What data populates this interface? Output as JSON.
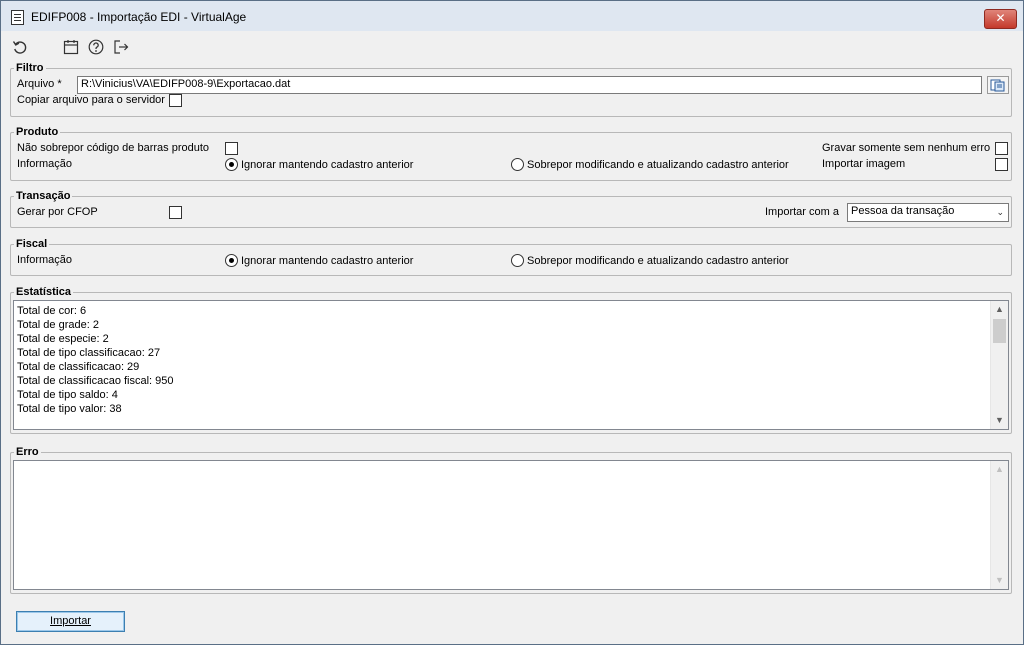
{
  "window": {
    "title": "EDIFP008 - Importação EDI - VirtualAge",
    "close_glyph": "✕"
  },
  "toolbar": {
    "icons": [
      "refresh-icon",
      "calendar-icon",
      "help-icon",
      "exit-icon"
    ]
  },
  "filtro": {
    "legend": "Filtro",
    "arquivo_label": "Arquivo *",
    "arquivo_value": "R:\\Vinicius\\VA\\EDIFP008-9\\Exportacao.dat",
    "copiar_label": "Copiar arquivo para o servidor",
    "copiar_checked": false
  },
  "produto": {
    "legend": "Produto",
    "nao_sobrepor_label": "Não sobrepor código de barras produto",
    "informacao_label": "Informação",
    "radio_ignorar": "Ignorar mantendo cadastro anterior",
    "radio_sobrepor": "Sobrepor modificando e atualizando cadastro anterior",
    "selected": "ignorar",
    "gravar_label": "Gravar somente sem nenhum erro",
    "importar_imagem_label": "Importar imagem"
  },
  "transacao": {
    "legend": "Transação",
    "gerar_cfop_label": "Gerar por CFOP",
    "importar_com_label": "Importar com a",
    "importar_com_value": "Pessoa da transação"
  },
  "fiscal": {
    "legend": "Fiscal",
    "informacao_label": "Informação",
    "radio_ignorar": "Ignorar mantendo cadastro anterior",
    "radio_sobrepor": "Sobrepor modificando e atualizando cadastro anterior",
    "selected": "ignorar"
  },
  "estatistica": {
    "legend": "Estatística",
    "lines": [
      "Total de cor: 6",
      "Total de grade: 2",
      "Total de especie: 2",
      "Total de tipo classificacao: 27",
      "Total de classificacao: 29",
      "Total de classificacao fiscal: 950",
      "Total de tipo saldo: 4",
      "Total de tipo valor: 38"
    ]
  },
  "erro": {
    "legend": "Erro",
    "content": ""
  },
  "actions": {
    "importar_label": "Importar"
  }
}
